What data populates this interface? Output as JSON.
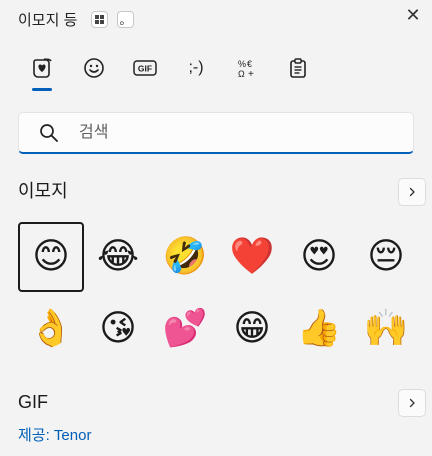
{
  "window": {
    "title": "이모지 등",
    "hint_dot": "。",
    "close_glyph": "✕"
  },
  "tabs": [
    {
      "name": "tab-emoji",
      "label": "heart-face-icon"
    },
    {
      "name": "tab-smiley",
      "label": "smiley-icon"
    },
    {
      "name": "tab-gif",
      "label": "GIF"
    },
    {
      "name": "tab-kaomoji",
      "label": ";-)"
    },
    {
      "name": "tab-symbols",
      "label": "symbols-icon"
    },
    {
      "name": "tab-clipboard",
      "label": "clipboard-icon"
    }
  ],
  "search": {
    "placeholder": "검색"
  },
  "emoji_section": {
    "title": "이모지",
    "items": [
      "😊",
      "😂",
      "🤣",
      "❤️",
      "😍",
      "😔",
      "👌",
      "😘",
      "💕",
      "😁",
      "👍",
      "🙌"
    ]
  },
  "gif_section": {
    "title": "GIF",
    "provider": "제공: Tenor"
  },
  "colors": {
    "accent": "#005fb8",
    "background": "#f3f3f3"
  }
}
